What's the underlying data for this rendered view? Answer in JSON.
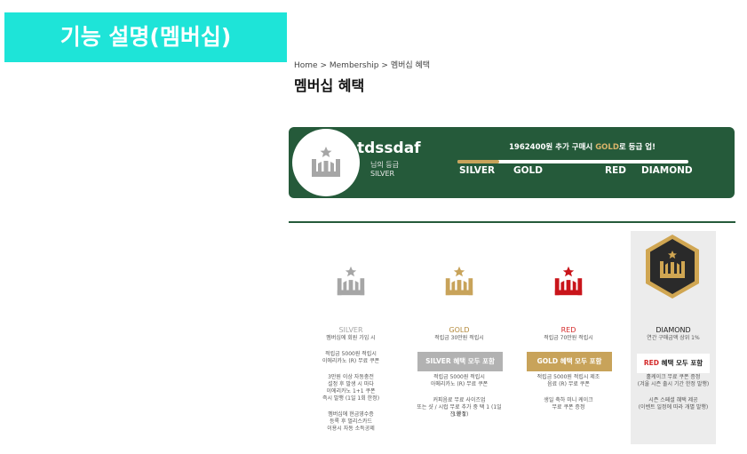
{
  "header": {
    "feature_tag": "기능 설명(멤버십)"
  },
  "breadcrumb": {
    "home": "Home",
    "sep": ">",
    "section": "Membership",
    "current": "멤버십 혜택"
  },
  "page_title": "멤버십 혜택",
  "status": {
    "username": "tdssdaf",
    "grade_label": "님의 등급",
    "current_grade": "SILVER",
    "upgrade_prefix": "1962400원 추가 구매시 ",
    "upgrade_grade": "GOLD",
    "upgrade_suffix": "로 등급 업!",
    "progress": 0.18,
    "levels": [
      "SILVER",
      "GOLD",
      "RED",
      "DIAMOND"
    ]
  },
  "colors": {
    "accent_teal": "#1ee4d8",
    "brand_green": "#255a3a",
    "gold": "#c8a35a",
    "red": "#c9151b",
    "silver": "#a6a6a6"
  },
  "tiers": {
    "silver": {
      "name": "SILVER",
      "condition": "멤버십에 회원 가입 시",
      "benefit1_l1": "적립금 5000원 적립시",
      "benefit1_l2": "이에리카노 (R) 무료 쿠폰",
      "benefit2_l1": "3만원 이상 자동충전",
      "benefit2_l2": "설정 후 발생 시 마다",
      "benefit2_l3": "이에리카노 1+1 쿠폰",
      "benefit2_l4": "즉시 발행 (1일 1회 한정)",
      "benefit3_l1": "멤버십에 현금영수증",
      "benefit3_l2": "등록 후 멀리스카드",
      "benefit3_l3": "이용시 자동 소득공제"
    },
    "gold": {
      "name": "GOLD",
      "condition": "적립금 30만원 적립시",
      "includes": "SILVER 혜택 모두 포함",
      "benefit1_l1": "적립금 5000원 적립시",
      "benefit1_l2": "아메리카노 (R) 무료 쿠폰",
      "benefit2_l1": "커피음료 무료 사이즈업",
      "benefit2_l2": "또는 샷 / 시럽 무료 추가 중 택 1 (1일 1회 1",
      "benefit2_l3": "잔 한정)"
    },
    "red": {
      "name": "RED",
      "condition": "적립금 70만원 적립시",
      "includes": "GOLD 혜택 모두 포함",
      "benefit1_l1": "적립금 5000원 적립시 제조",
      "benefit1_l2": "음료 (R) 무료 쿠폰",
      "benefit2_l1": "생일 축하 미니 케이크",
      "benefit2_l2": "무료 쿠폰 증정"
    },
    "diamond": {
      "name": "DIAMOND",
      "condition": "연간 구매금액 상위 1%",
      "includes_red": "RED",
      "includes_rest": " 혜택 모두 포함",
      "benefit1_l1": "홀케이크 무료 쿠폰 증정",
      "benefit1_l2": "(겨울 시즌 출시 기간 한정 발행)",
      "benefit2_l1": "시즌 스페셜 혜택 제공",
      "benefit2_l2": "(이벤트 일정에 따라 개별 발행)"
    }
  }
}
